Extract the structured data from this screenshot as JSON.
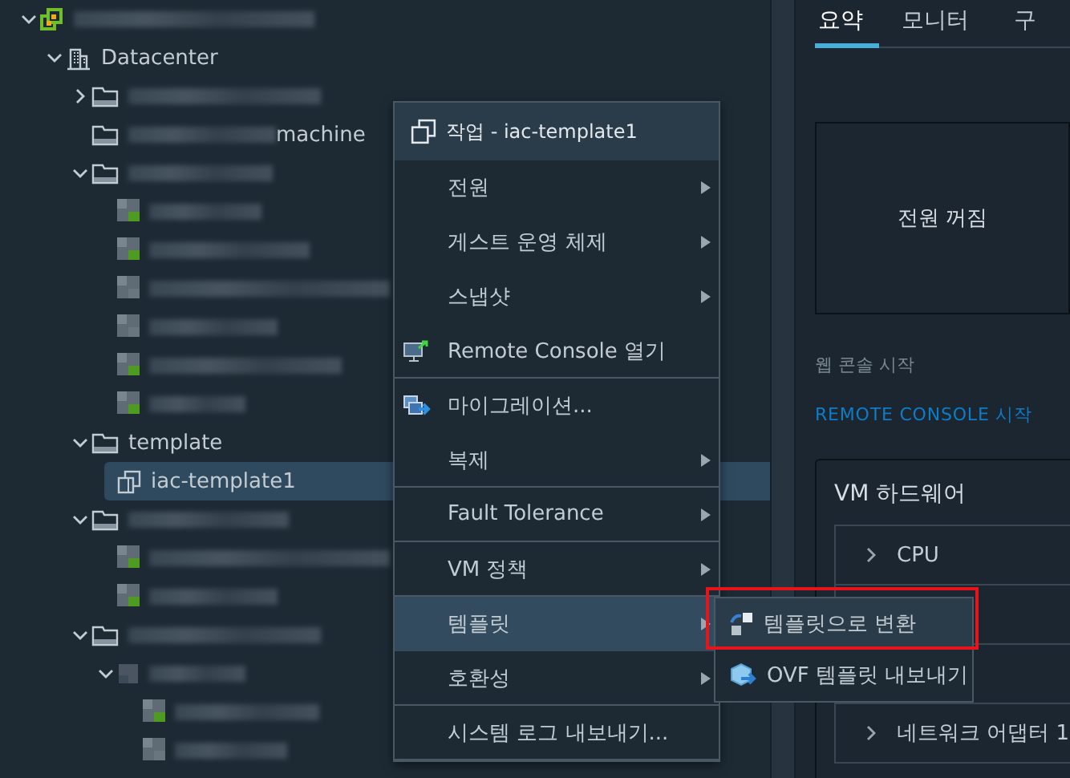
{
  "tree": [
    {
      "kind": "root",
      "redacted": true,
      "expanded": true,
      "selected": false,
      "children": [
        {
          "kind": "datacenter",
          "label": "Datacenter",
          "expanded": true,
          "selected": false,
          "children": [
            {
              "kind": "folder",
              "redacted": true,
              "expanded": false,
              "selected": false
            },
            {
              "kind": "folder",
              "redacted": true,
              "label": "machine",
              "selected": false
            },
            {
              "kind": "folder",
              "redacted": true,
              "expanded": true,
              "selected": false,
              "children": [
                {
                  "kind": "vm",
                  "redacted": true,
                  "powered_on": true,
                  "selected": false
                },
                {
                  "kind": "vm",
                  "redacted": true,
                  "powered_on": true,
                  "selected": false
                },
                {
                  "kind": "vm",
                  "redacted": true,
                  "powered_on": false,
                  "selected": false
                },
                {
                  "kind": "vm",
                  "redacted": true,
                  "powered_on": false,
                  "selected": false
                },
                {
                  "kind": "vm",
                  "redacted": true,
                  "powered_on": true,
                  "selected": false
                },
                {
                  "kind": "vm",
                  "redacted": true,
                  "powered_on": true,
                  "selected": false
                }
              ]
            },
            {
              "kind": "folder",
              "label": "template",
              "expanded": true,
              "selected": false,
              "children": [
                {
                  "kind": "template",
                  "label": "iac-template1",
                  "selected": true
                }
              ]
            },
            {
              "kind": "folder",
              "redacted": true,
              "expanded": true,
              "selected": false,
              "children": [
                {
                  "kind": "vm",
                  "redacted": true,
                  "powered_on": true,
                  "selected": false
                },
                {
                  "kind": "vm",
                  "redacted": true,
                  "powered_on": true,
                  "selected": false
                }
              ]
            },
            {
              "kind": "folder",
              "redacted": true,
              "expanded": true,
              "selected": false,
              "children": [
                {
                  "kind": "vapp",
                  "redacted": true,
                  "expanded": true,
                  "selected": false,
                  "children": [
                    {
                      "kind": "vm",
                      "redacted": true,
                      "powered_on": true,
                      "selected": false
                    },
                    {
                      "kind": "vm",
                      "redacted": true,
                      "powered_on": false,
                      "selected": false
                    }
                  ]
                }
              ]
            }
          ]
        }
      ]
    }
  ],
  "tabs": [
    {
      "label": "요약",
      "selected": true
    },
    {
      "label": "모니터",
      "selected": false
    },
    {
      "label": "구",
      "selected": false
    }
  ],
  "console": {
    "state": "전원 꺼짐",
    "web_console": "웹 콘솔 시작",
    "remote_console": "REMOTE CONSOLE 시작"
  },
  "hardware": {
    "title": "VM 하드웨어",
    "rows": [
      {
        "kind": "item",
        "label": "CPU"
      },
      {
        "kind": "covered"
      },
      {
        "kind": "covered"
      },
      {
        "kind": "item",
        "label": "네트워크 어댑터 1"
      }
    ]
  },
  "context_menu": {
    "title": "작업 - iac-template1",
    "items": [
      {
        "label": "전원",
        "kind": "plain",
        "submenu": true,
        "selected": false,
        "divider_after": false
      },
      {
        "label": "게스트 운영 체제",
        "kind": "plain",
        "submenu": true,
        "selected": false,
        "divider_after": false
      },
      {
        "label": "스냅샷",
        "kind": "plain",
        "submenu": true,
        "selected": false,
        "divider_after": false
      },
      {
        "label": "Remote Console 열기",
        "kind": "console",
        "submenu": false,
        "selected": false,
        "divider_after": true
      },
      {
        "label": "마이그레이션...",
        "kind": "migrate",
        "submenu": false,
        "selected": false,
        "divider_after": false
      },
      {
        "label": "복제",
        "kind": "plain",
        "submenu": true,
        "selected": false,
        "divider_after": true
      },
      {
        "label": "Fault Tolerance",
        "kind": "plain",
        "submenu": true,
        "selected": false,
        "divider_after": true
      },
      {
        "label": "VM 정책",
        "kind": "plain",
        "submenu": true,
        "selected": false,
        "divider_after": true
      },
      {
        "label": "템플릿",
        "kind": "plain",
        "submenu": true,
        "selected": true,
        "divider_after": false
      },
      {
        "label": "호환성",
        "kind": "plain",
        "submenu": true,
        "selected": false,
        "divider_after": true
      },
      {
        "label": "시스템 로그 내보내기...",
        "kind": "plain",
        "submenu": false,
        "selected": false,
        "divider_after": true
      }
    ]
  },
  "submenu": {
    "items": [
      {
        "label": "템플릿으로 변환",
        "kind": "convert",
        "selected": true,
        "marked": true
      },
      {
        "label": "OVF 템플릿 내보내기",
        "kind": "ovf",
        "selected": false,
        "marked": false
      }
    ]
  }
}
